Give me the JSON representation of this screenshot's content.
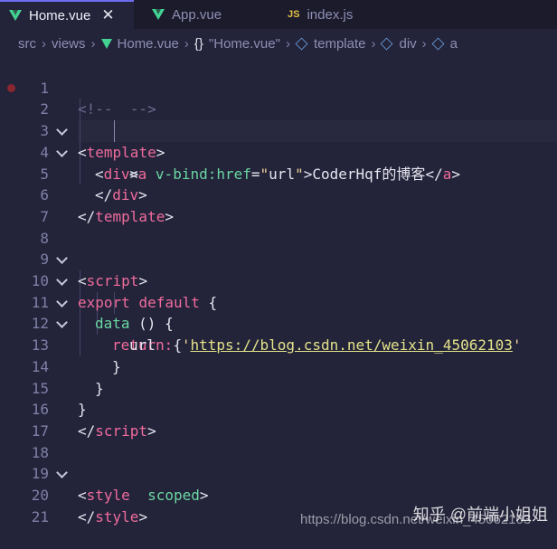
{
  "tabs": [
    {
      "label": "Home.vue",
      "icon": "vue-icon",
      "active": true,
      "close": "✕"
    },
    {
      "label": "App.vue",
      "icon": "vue-icon",
      "active": false
    },
    {
      "label": "index.js",
      "icon": "js-icon",
      "icon_text": "JS",
      "active": false
    }
  ],
  "breadcrumb": {
    "items": [
      "src",
      "views",
      "Home.vue",
      "\"Home.vue\"",
      "template",
      "div",
      "a"
    ],
    "braces": "{}"
  },
  "lines": [
    {
      "n": "1"
    },
    {
      "n": "2"
    },
    {
      "n": "3"
    },
    {
      "n": "4"
    },
    {
      "n": "5"
    },
    {
      "n": "6"
    },
    {
      "n": "7"
    },
    {
      "n": "8"
    },
    {
      "n": "9"
    },
    {
      "n": "10"
    },
    {
      "n": "11"
    },
    {
      "n": "12"
    },
    {
      "n": "13"
    },
    {
      "n": "14"
    },
    {
      "n": "15"
    },
    {
      "n": "16"
    },
    {
      "n": "17"
    },
    {
      "n": "18"
    },
    {
      "n": "19"
    },
    {
      "n": "20"
    },
    {
      "n": "21"
    }
  ],
  "code": {
    "l1": "<!--  -->",
    "l2_open": "<",
    "l2_tag": "template",
    "l2_close": ">",
    "l3_open": "<",
    "l3_tag": "div",
    "l3_close": ">",
    "l4_lt": "<",
    "l4_tag": "a",
    "l4_attr": "v-bind:href",
    "l4_eq": "=",
    "l4_q1": "\"",
    "l4_val": "url",
    "l4_q2": "\"",
    "l4_gt": ">",
    "l4_text": "CoderHqf的博客",
    "l4_end_lt": "</",
    "l4_end_tag": "a",
    "l4_end_gt": ">",
    "l5_open": "</",
    "l5_tag": "div",
    "l5_close": ">",
    "l6_open": "</",
    "l6_tag": "template",
    "l6_close": ">",
    "l8_open": "<",
    "l8_tag": "script",
    "l8_close": ">",
    "l9_kw1": "export",
    "l9_kw2": "default",
    "l9_brace": "{",
    "l10_fn": "data",
    "l10_rest": "() {",
    "l11_kw": "return",
    "l11_brace": "{",
    "l12_prop": "url",
    "l12_colon": ":",
    "l12_q1": "'",
    "l12_url": "https://blog.csdn.net/weixin_45062103",
    "l12_q2": "'",
    "l13": "}",
    "l14": "}",
    "l15": "}",
    "l16_open": "</",
    "l16_tag": "script",
    "l16_close": ">",
    "l18_open": "<",
    "l18_tag": "style",
    "l18_attr": "scoped",
    "l18_close": ">",
    "l20_open": "</",
    "l20_tag": "style",
    "l20_close": ">"
  },
  "watermark": {
    "zhihu": "知乎 @前端小姐姐",
    "csdn": "https://blog.csdn.net/weixin_45062103"
  },
  "colors": {
    "background": "#23233a",
    "tag": "#f06c9c",
    "attribute": "#6ad7a1",
    "string": "#f0d49a",
    "active_tab_border": "#6d6df0"
  }
}
